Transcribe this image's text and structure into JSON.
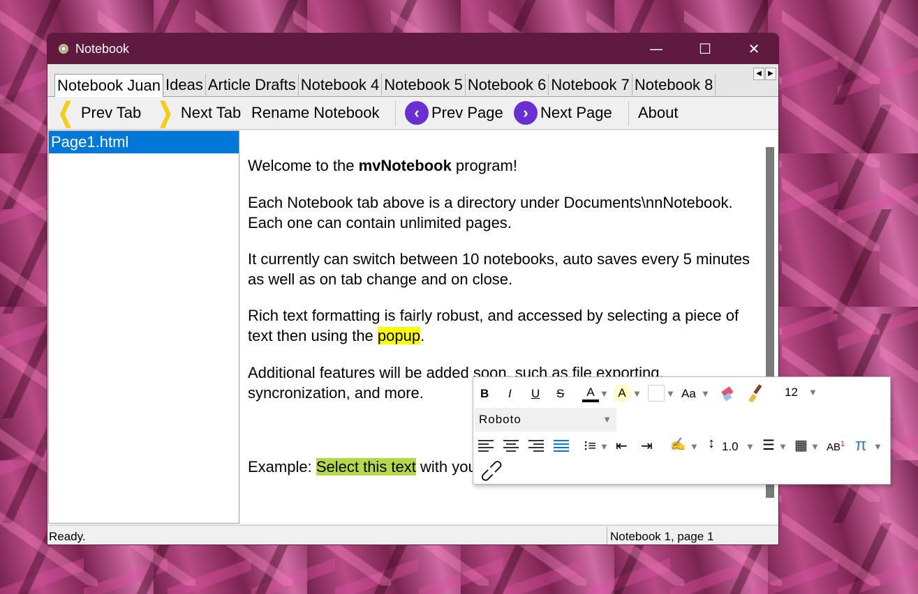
{
  "window": {
    "title": "Notebook",
    "controls": {
      "minimize": "—",
      "maximize": "☐",
      "close": "✕"
    }
  },
  "tabs": [
    {
      "label": "Notebook Juan",
      "active": true
    },
    {
      "label": "Ideas"
    },
    {
      "label": "Article Drafts"
    },
    {
      "label": "Notebook 4"
    },
    {
      "label": "Notebook 5"
    },
    {
      "label": "Notebook 6"
    },
    {
      "label": "Notebook 7"
    },
    {
      "label": "Notebook 8"
    }
  ],
  "toolbar": {
    "prev_tab": "Prev Tab",
    "next_tab": "Next Tab",
    "rename": "Rename Notebook",
    "prev_page": "Prev Page",
    "next_page": "Next Page",
    "about": "About"
  },
  "sidebar": {
    "pages": [
      "Page1.html"
    ]
  },
  "document": {
    "p1_pre": "Welcome to the ",
    "p1_bold": "mvNotebook",
    "p1_post": " program!",
    "p2": "Each Notebook tab above is a directory under Documents\\nnNotebook. Each one can contain unlimited pages.",
    "p3": "It currently can switch between 10 notebooks, auto saves every 5 minutes as well as on tab change and on close.",
    "p4_pre": "Rich text formatting is fairly robust, and accessed by selecting a piece of text then using the ",
    "p4_hl": "popup",
    "p4_post": ".",
    "p5": "Additional features will be added soon, such as file exporting, syncronization, and more.",
    "p6_pre": "Example: ",
    "p6_hl": "Select this text",
    "p6_post": " with your mouse to see the formatting toolbar"
  },
  "status": {
    "left": "Ready.",
    "right": "Notebook 1, page 1"
  },
  "popup": {
    "bold": "B",
    "italic": "I",
    "underline": "U",
    "strike": "S",
    "font_color": "A",
    "highlight": "A",
    "case": "Aa",
    "font_size": "12",
    "font_name": "Roboto",
    "line_spacing": "1.0",
    "superscript": "AB",
    "superscript_mark": "1",
    "math": "π"
  }
}
